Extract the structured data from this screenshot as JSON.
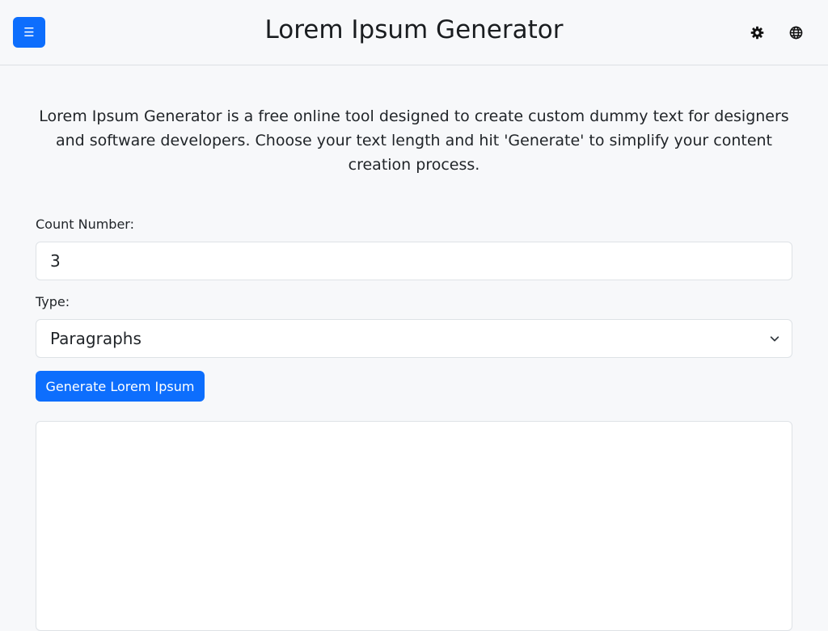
{
  "header": {
    "title": "Lorem Ipsum Generator",
    "menu_icon": "menu-icon",
    "theme_icon": "gear-icon",
    "language_icon": "globe-icon"
  },
  "intro": {
    "text": "Lorem Ipsum Generator is a free online tool designed to create custom dummy text for designers and software developers. Choose your text length and hit 'Generate' to simplify your content creation process."
  },
  "form": {
    "count_label": "Count Number:",
    "count_value": "3",
    "type_label": "Type:",
    "type_value": "Paragraphs",
    "generate_label": "Generate Lorem Ipsum",
    "output_text": ""
  },
  "colors": {
    "accent": "#0d6efd",
    "background": "#f7f8fa",
    "field_bg": "#ffffff",
    "border": "#dee2e6"
  }
}
